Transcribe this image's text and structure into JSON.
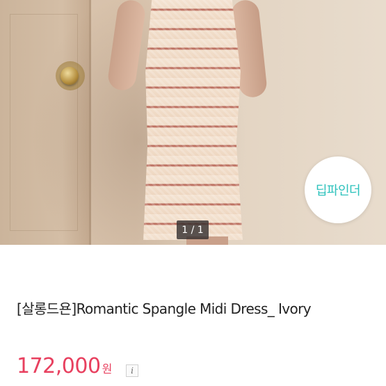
{
  "product_image": {
    "brand_badge": "딥파인더",
    "counter": "1 / 1"
  },
  "product": {
    "title": "[살롱드욘]Romantic Spangle Midi Dress_ Ivory",
    "price": "172,000",
    "currency": "원",
    "info_icon_glyph": "i"
  },
  "colors": {
    "price": "#e8405f",
    "brand_badge_text": "#2dc2bc"
  }
}
